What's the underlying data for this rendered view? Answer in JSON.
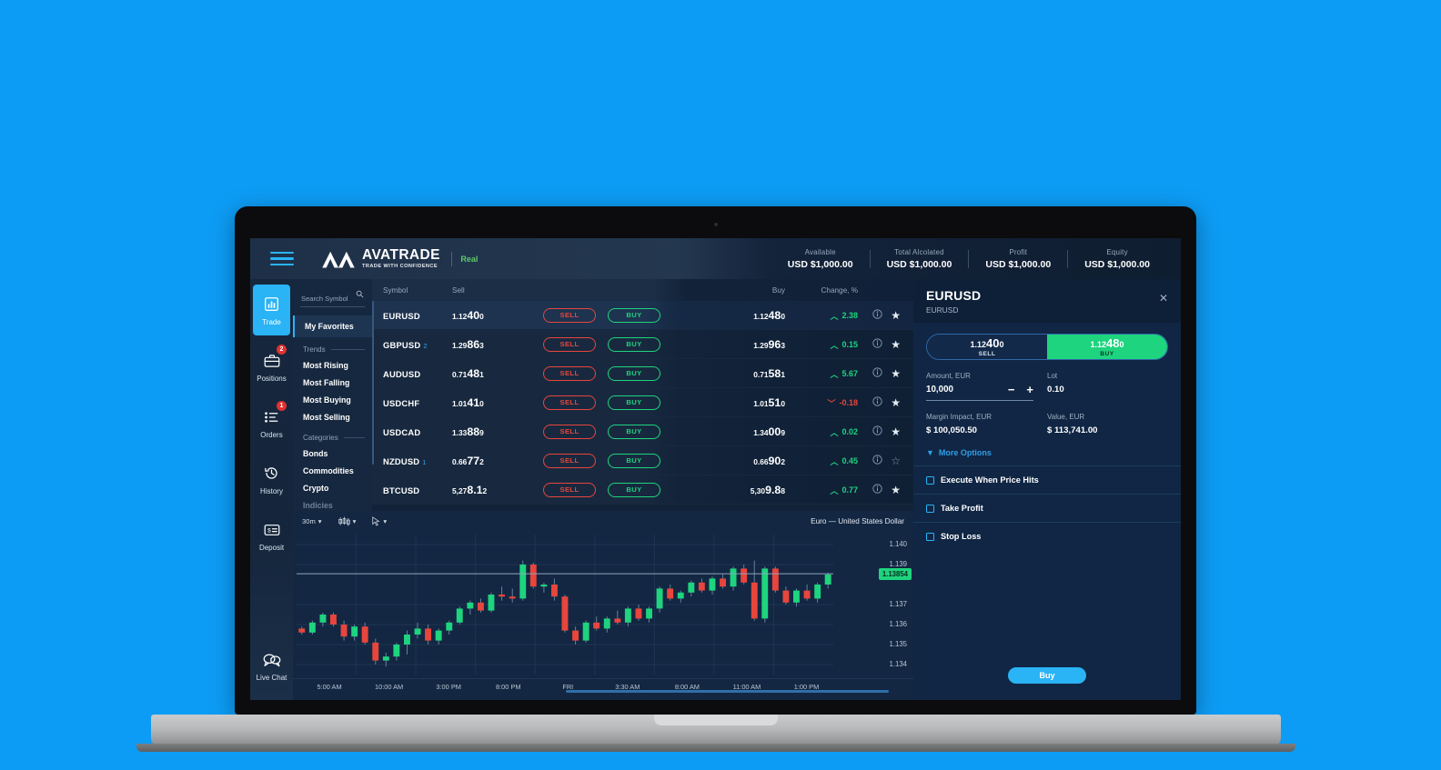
{
  "brand": {
    "name": "AVATRADE",
    "tagline": "TRADE WITH CONFIDENCE",
    "account_mode": "Real"
  },
  "header": {
    "accounts": [
      {
        "label": "Available",
        "value": "USD $1,000.00"
      },
      {
        "label": "Total Alcolated",
        "value": "USD $1,000.00"
      },
      {
        "label": "Profit",
        "value": "USD $1,000.00"
      },
      {
        "label": "Equity",
        "value": "USD $1,000.00"
      }
    ]
  },
  "sidebar": {
    "items": [
      {
        "label": "Trade",
        "icon": "bar-chart-icon",
        "active": true,
        "badge": ""
      },
      {
        "label": "Positions",
        "icon": "briefcase-icon",
        "active": false,
        "badge": "2"
      },
      {
        "label": "Orders",
        "icon": "list-icon",
        "active": false,
        "badge": "1"
      },
      {
        "label": "History",
        "icon": "clock-rewind-icon",
        "active": false,
        "badge": ""
      },
      {
        "label": "Deposit",
        "icon": "card-icon",
        "active": false,
        "badge": ""
      }
    ],
    "chat": {
      "label": "Live Chat",
      "icon": "chat-bubble-icon"
    }
  },
  "categories": {
    "search_placeholder": "Search Symbol",
    "favorites": "My Favorites",
    "groups": [
      {
        "title": "Trends",
        "items": [
          "Most Rising",
          "Most Falling",
          "Most Buying",
          "Most Selling"
        ]
      },
      {
        "title": "Categories",
        "items": [
          "Bonds",
          "Commodities",
          "Crypto",
          "Indicies"
        ]
      }
    ]
  },
  "quotes": {
    "columns": [
      "Symbol",
      "Sell",
      "Buy",
      "Change, %"
    ],
    "sell_button": "SELL",
    "buy_button": "BUY",
    "rows": [
      {
        "symbol": "EURUSD",
        "count": "",
        "sell": [
          "1.12",
          "40",
          "0"
        ],
        "buy": [
          "1.12",
          "48",
          "0"
        ],
        "change": "2.38",
        "dir": "up",
        "fav": true,
        "selected": true
      },
      {
        "symbol": "GBPUSD",
        "count": "2",
        "sell": [
          "1.29",
          "86",
          "3"
        ],
        "buy": [
          "1.29",
          "96",
          "3"
        ],
        "change": "0.15",
        "dir": "up",
        "fav": true,
        "selected": false
      },
      {
        "symbol": "AUDUSD",
        "count": "",
        "sell": [
          "0.71",
          "48",
          "1"
        ],
        "buy": [
          "0.71",
          "58",
          "1"
        ],
        "change": "5.67",
        "dir": "up",
        "fav": true,
        "selected": false
      },
      {
        "symbol": "USDCHF",
        "count": "",
        "sell": [
          "1.01",
          "41",
          "0"
        ],
        "buy": [
          "1.01",
          "51",
          "0"
        ],
        "change": "-0.18",
        "dir": "down",
        "fav": true,
        "selected": false
      },
      {
        "symbol": "USDCAD",
        "count": "",
        "sell": [
          "1.33",
          "88",
          "9"
        ],
        "buy": [
          "1.34",
          "00",
          "9"
        ],
        "change": "0.02",
        "dir": "up",
        "fav": true,
        "selected": false
      },
      {
        "symbol": "NZDUSD",
        "count": "1",
        "sell": [
          "0.66",
          "77",
          "2"
        ],
        "buy": [
          "0.66",
          "90",
          "2"
        ],
        "change": "0.45",
        "dir": "up",
        "fav": false,
        "selected": false
      },
      {
        "symbol": "BTCUSD",
        "count": "",
        "sell": [
          "5,27",
          "8.1",
          "2"
        ],
        "buy": [
          "5,30",
          "9.8",
          "8"
        ],
        "change": "0.77",
        "dir": "up",
        "fav": true,
        "selected": false
      }
    ]
  },
  "chart_data": {
    "type": "candlestick",
    "title": "Euro — United States Dollar",
    "timeframe": "30m",
    "chart_type_icon": "candlestick-icon",
    "cursor_icon": "crosshair-icon",
    "xlabel": "",
    "ylabel": "",
    "ylim": [
      1.1335,
      1.1405
    ],
    "ytick_labels": [
      "1.140",
      "1.139",
      "1.137",
      "1.136",
      "1.135",
      "1.134"
    ],
    "xtick_labels": [
      "5:00 AM",
      "10:00 AM",
      "3:00 PM",
      "8:00 PM",
      "FRI",
      "3:30 AM",
      "8:00 AM",
      "11:00 AM",
      "1:00 PM"
    ],
    "last_price": "1.13854",
    "last_price_color": "#1ed47e",
    "up_color": "#1ed47e",
    "down_color": "#e8453c",
    "grid": true,
    "candles": [
      [
        1.1358,
        1.1359,
        1.1355,
        1.1356
      ],
      [
        1.1356,
        1.1362,
        1.1355,
        1.1361
      ],
      [
        1.1361,
        1.1366,
        1.1359,
        1.1365
      ],
      [
        1.1365,
        1.1366,
        1.1359,
        1.136
      ],
      [
        1.136,
        1.1362,
        1.1352,
        1.1354
      ],
      [
        1.1354,
        1.136,
        1.1352,
        1.1359
      ],
      [
        1.1359,
        1.1361,
        1.135,
        1.1351
      ],
      [
        1.1351,
        1.1353,
        1.134,
        1.1342
      ],
      [
        1.1342,
        1.1346,
        1.1339,
        1.1344
      ],
      [
        1.1344,
        1.1351,
        1.1342,
        1.135
      ],
      [
        1.135,
        1.1357,
        1.1345,
        1.1355
      ],
      [
        1.1355,
        1.1361,
        1.1353,
        1.1358
      ],
      [
        1.1358,
        1.136,
        1.135,
        1.1352
      ],
      [
        1.1352,
        1.1358,
        1.135,
        1.1357
      ],
      [
        1.1357,
        1.1362,
        1.1355,
        1.1361
      ],
      [
        1.1361,
        1.1369,
        1.136,
        1.1368
      ],
      [
        1.1368,
        1.1372,
        1.1365,
        1.1371
      ],
      [
        1.1371,
        1.1373,
        1.1366,
        1.1367
      ],
      [
        1.1367,
        1.1376,
        1.1366,
        1.1375
      ],
      [
        1.1375,
        1.1379,
        1.1372,
        1.1374
      ],
      [
        1.1374,
        1.1378,
        1.1371,
        1.1373
      ],
      [
        1.1373,
        1.1392,
        1.1372,
        1.139
      ],
      [
        1.139,
        1.1391,
        1.1378,
        1.1379
      ],
      [
        1.1379,
        1.1381,
        1.1376,
        1.138
      ],
      [
        1.138,
        1.1383,
        1.1372,
        1.1374
      ],
      [
        1.1374,
        1.1375,
        1.1356,
        1.1357
      ],
      [
        1.1357,
        1.1359,
        1.135,
        1.1352
      ],
      [
        1.1352,
        1.1362,
        1.1351,
        1.1361
      ],
      [
        1.1361,
        1.1364,
        1.1357,
        1.1358
      ],
      [
        1.1358,
        1.1364,
        1.1356,
        1.1363
      ],
      [
        1.1363,
        1.1367,
        1.136,
        1.1361
      ],
      [
        1.1361,
        1.1369,
        1.1359,
        1.1368
      ],
      [
        1.1368,
        1.137,
        1.1362,
        1.1363
      ],
      [
        1.1363,
        1.1369,
        1.1361,
        1.1368
      ],
      [
        1.1368,
        1.1379,
        1.1366,
        1.1378
      ],
      [
        1.1378,
        1.138,
        1.1372,
        1.1373
      ],
      [
        1.1373,
        1.1377,
        1.1371,
        1.1376
      ],
      [
        1.1376,
        1.1382,
        1.1374,
        1.1381
      ],
      [
        1.1381,
        1.1383,
        1.1376,
        1.1377
      ],
      [
        1.1377,
        1.1384,
        1.1375,
        1.1383
      ],
      [
        1.1383,
        1.1385,
        1.1378,
        1.1379
      ],
      [
        1.1379,
        1.1389,
        1.1377,
        1.1388
      ],
      [
        1.1388,
        1.139,
        1.138,
        1.1381
      ],
      [
        1.1381,
        1.1392,
        1.1362,
        1.1363
      ],
      [
        1.1363,
        1.1389,
        1.1361,
        1.1388
      ],
      [
        1.1388,
        1.1389,
        1.1376,
        1.1377
      ],
      [
        1.1377,
        1.1379,
        1.137,
        1.1371
      ],
      [
        1.1371,
        1.1378,
        1.1369,
        1.1377
      ],
      [
        1.1377,
        1.138,
        1.1372,
        1.1373
      ],
      [
        1.1373,
        1.1381,
        1.1371,
        1.138
      ],
      [
        1.138,
        1.1386,
        1.1378,
        1.1385
      ]
    ]
  },
  "ticket": {
    "title": "EURUSD",
    "subtitle": "EURUSD",
    "close_icon": "close-icon",
    "sell": {
      "price": [
        "1.12",
        "40",
        "0"
      ],
      "tag": "SELL"
    },
    "buy": {
      "price": [
        "1.12",
        "48",
        "0"
      ],
      "tag": "BUY"
    },
    "amount_label": "Amount, EUR",
    "amount_value": "10,000",
    "lot_label": "Lot",
    "lot_value": "0.10",
    "margin_label": "Margin Impact, EUR",
    "margin_value": "$ 100,050.50",
    "value_label": "Value, EUR",
    "value_value": "$ 113,741.00",
    "more_options": "More Options",
    "options": [
      "Execute When Price Hits",
      "Take Profit",
      "Stop Loss"
    ],
    "submit_label": "Buy"
  },
  "colors": {
    "accent": "#2ab3f5",
    "up": "#1ed47e",
    "down": "#e8453c",
    "background": "#0d9cf5"
  }
}
